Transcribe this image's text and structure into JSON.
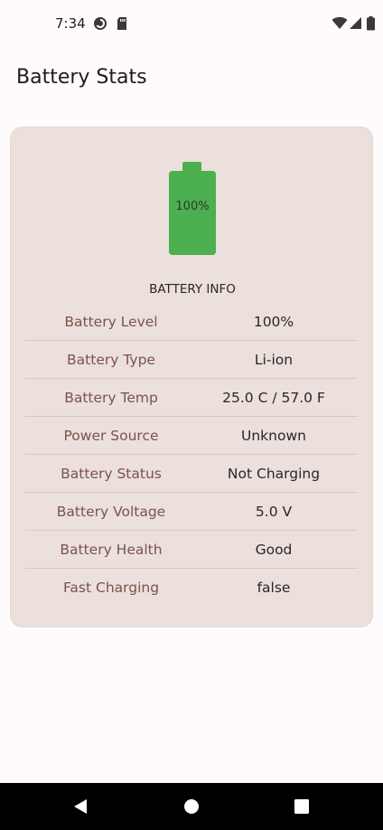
{
  "status_bar": {
    "time": "7:34"
  },
  "header": {
    "title": "Battery Stats"
  },
  "battery": {
    "level_text": "100%",
    "level_fraction": 1.0,
    "color": "#4caf50"
  },
  "info": {
    "section_title": "BATTERY INFO",
    "rows": [
      {
        "label": "Battery Level",
        "value": "100%"
      },
      {
        "label": "Battery Type",
        "value": "Li-ion"
      },
      {
        "label": "Battery Temp",
        "value": "25.0 C / 57.0 F"
      },
      {
        "label": "Power Source",
        "value": "Unknown"
      },
      {
        "label": "Battery Status",
        "value": "Not Charging"
      },
      {
        "label": "Battery Voltage",
        "value": "5.0 V"
      },
      {
        "label": "Battery Health",
        "value": "Good"
      },
      {
        "label": "Fast Charging",
        "value": "false"
      }
    ]
  },
  "icons": {
    "status": [
      "data-saver-icon",
      "sd-card-icon",
      "wifi-icon",
      "cell-signal-icon",
      "battery-icon"
    ],
    "nav": [
      "back-icon",
      "home-icon",
      "recents-icon"
    ]
  },
  "colors": {
    "background": "#fffbfd",
    "card": "#ebe0dc",
    "label": "#7a544a",
    "battery_green": "#4caf50"
  }
}
